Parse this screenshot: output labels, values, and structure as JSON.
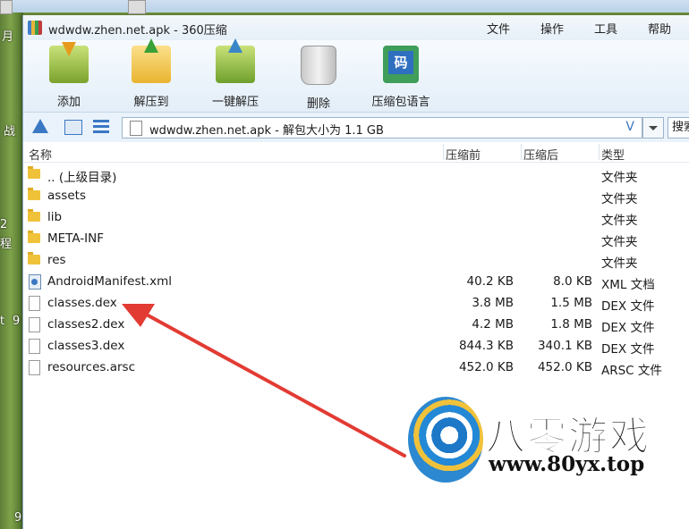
{
  "window": {
    "title": "wdwdw.zhen.net.apk - 360压缩"
  },
  "menu": [
    "文件",
    "操作",
    "工具",
    "帮助"
  ],
  "toolbar": [
    {
      "label": "添加",
      "icon": "add-archive-icon"
    },
    {
      "label": "解压到",
      "icon": "extract-to-icon"
    },
    {
      "label": "一键解压",
      "icon": "one-click-extract-icon"
    },
    {
      "label": "删除",
      "icon": "delete-bin-icon"
    },
    {
      "label": "压缩包语言",
      "icon": "archive-language-icon",
      "glyph": "码"
    }
  ],
  "address": {
    "text": "wdwdw.zhen.net.apk - 解包大小为 1.1 GB",
    "history_glyph": "V"
  },
  "search": {
    "placeholder": "搜索"
  },
  "columns": {
    "name": "名称",
    "before": "压缩前",
    "after": "压缩后",
    "type": "类型"
  },
  "files": [
    {
      "name": ".. (上级目录)",
      "before": "",
      "after": "",
      "type": "文件夹",
      "kind": "folder"
    },
    {
      "name": "assets",
      "before": "",
      "after": "",
      "type": "文件夹",
      "kind": "folder"
    },
    {
      "name": "lib",
      "before": "",
      "after": "",
      "type": "文件夹",
      "kind": "folder"
    },
    {
      "name": "META-INF",
      "before": "",
      "after": "",
      "type": "文件夹",
      "kind": "folder"
    },
    {
      "name": "res",
      "before": "",
      "after": "",
      "type": "文件夹",
      "kind": "folder"
    },
    {
      "name": "AndroidManifest.xml",
      "before": "40.2 KB",
      "after": "8.0 KB",
      "type": "XML 文档",
      "kind": "xml"
    },
    {
      "name": "classes.dex",
      "before": "3.8 MB",
      "after": "1.5 MB",
      "type": "DEX 文件",
      "kind": "file"
    },
    {
      "name": "classes2.dex",
      "before": "4.2 MB",
      "after": "1.8 MB",
      "type": "DEX 文件",
      "kind": "file"
    },
    {
      "name": "classes3.dex",
      "before": "844.3 KB",
      "after": "340.1 KB",
      "type": "DEX 文件",
      "kind": "file"
    },
    {
      "name": "resources.arsc",
      "before": "452.0 KB",
      "after": "452.0 KB",
      "type": "ARSC 文件",
      "kind": "file"
    }
  ],
  "watermark": {
    "name": "八零游戏",
    "url": "www.80yx.top"
  },
  "desktop_text": [
    "月",
    "战",
    "2",
    "程",
    "t",
    "9",
    "9"
  ],
  "colors": {
    "arrow": "#e23b33",
    "accent": "#3b78c4"
  }
}
